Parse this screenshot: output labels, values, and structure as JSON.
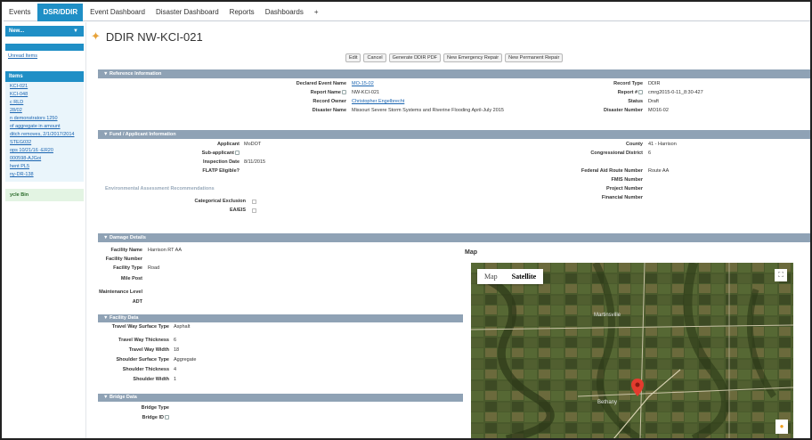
{
  "topnav": {
    "tabs": [
      "Events",
      "DSR/DDIR",
      "Event Dashboard",
      "Disaster Dashboard",
      "Reports",
      "Dashboards",
      "+"
    ]
  },
  "sidebar": {
    "new_label": "New...",
    "unread_label": "Unread Items",
    "items_header": "Items",
    "recent_links": [
      "KCI-021",
      "KCI-048",
      "c RLD",
      "28/02",
      "n demonstrators 1250",
      "of aggregate in amount",
      "ditch removes, 2/1/2017/2014",
      "STEG032",
      "ops 10/21/16 -ER20",
      "000598-AJGoi",
      "hent PL5",
      "ny-DR-138"
    ],
    "green_label": "ycle Bin"
  },
  "page": {
    "title": "DDIR NW-KCI-021"
  },
  "buttons": [
    "Edit",
    "Cancel",
    "Generate DDIR PDF",
    "New Emergency Repair",
    "New Permanent Repair"
  ],
  "reference": {
    "header": "▼ Reference Information",
    "left": [
      {
        "label": "Declared Event Name",
        "value": "MO-15-02",
        "link": true
      },
      {
        "label": "Report Name",
        "value": "NW-KCI-021",
        "link": false
      },
      {
        "label": "Record Owner",
        "value": "Christopher Engelbrecht",
        "link": true
      },
      {
        "label": "Disaster Name",
        "value": "Missouri Severe Storm Systems and Riverine Flooding April-July 2015",
        "link": false
      }
    ],
    "right": [
      {
        "label": "Record Type",
        "value": "DDIR"
      },
      {
        "label": "Report #",
        "value": "cmrg2015-0-11_8:30-427"
      },
      {
        "label": "Status",
        "value": "Draft"
      },
      {
        "label": "Disaster Number",
        "value": "MO16-02"
      }
    ]
  },
  "applicant": {
    "header": "▼ Fund / Applicant Information",
    "left": [
      {
        "label": "Applicant",
        "value": "MoDOT"
      },
      {
        "label": "Sub-applicant",
        "value": ""
      },
      {
        "label": "Inspection Date",
        "value": "8/11/2015"
      },
      {
        "label": "FLATP Eligible?",
        "value": ""
      }
    ],
    "right": [
      {
        "label": "County",
        "value": "41 - Harrison"
      },
      {
        "label": "Congressional District",
        "value": "6"
      },
      {
        "label": "Federal Aid Route Number",
        "value": "Route AA"
      },
      {
        "label": "FMIS Number",
        "value": ""
      },
      {
        "label": "Project Number",
        "value": ""
      },
      {
        "label": "Financial Number",
        "value": ""
      }
    ],
    "env_heading": "Environmental Assessment Recommendations",
    "env_items": [
      "Categorical Exclusion",
      "EA/EIS"
    ]
  },
  "damage": {
    "header": "▼ Damage Details",
    "fields": [
      {
        "label": "Facility Name",
        "value": "Harrison RT AA"
      },
      {
        "label": "Facility Number",
        "value": ""
      },
      {
        "label": "Facility Type",
        "value": "Road"
      },
      {
        "label": "Mile Post",
        "value": ""
      },
      {
        "label": "Maintenance Level",
        "value": ""
      },
      {
        "label": "ADT",
        "value": ""
      }
    ],
    "facility_header": "▼ Facility Data",
    "facility_fields": [
      {
        "label": "Travel Way Surface Type",
        "value": "Asphalt"
      },
      {
        "label": "Travel Way Thickness",
        "value": "6"
      },
      {
        "label": "Travel Way Width",
        "value": "18"
      },
      {
        "label": "Shoulder Surface Type",
        "value": "Aggregate"
      },
      {
        "label": "Shoulder Thickness",
        "value": "4"
      },
      {
        "label": "Shoulder Width",
        "value": "1"
      }
    ],
    "bridge_header": "▼ Bridge Data",
    "bridge_fields": [
      {
        "label": "Bridge Type",
        "value": ""
      },
      {
        "label": "Bridge ID",
        "value": ""
      }
    ]
  },
  "map": {
    "title": "Map",
    "type_map": "Map",
    "type_satellite": "Satellite",
    "town_label_1": "Martinsville",
    "town_label_2": "Bethany"
  }
}
